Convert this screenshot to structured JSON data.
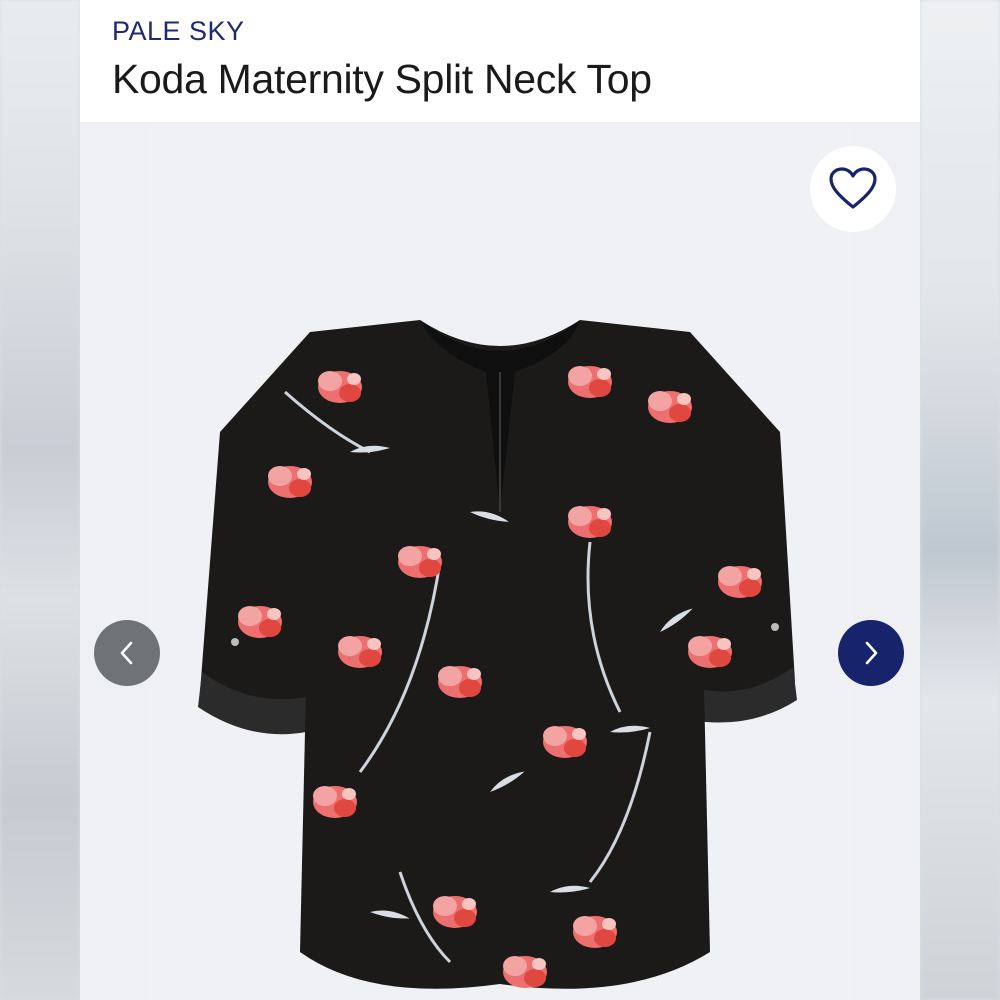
{
  "product": {
    "brand": "PALE SKY",
    "title": "Koda Maternity Split Neck Top"
  },
  "gallery": {
    "image_alt": "Koda Maternity Split Neck Top",
    "favorite_icon": "heart-outline-icon",
    "prev_icon": "chevron-left-icon",
    "next_icon": "chevron-right-icon"
  },
  "colors": {
    "brand_text": "#1f2b6e",
    "next_button": "#17246b",
    "prev_button": "#707376",
    "gallery_bg": "#eef0f3",
    "garment": "#1b1a19",
    "flower": "#ee6f6f"
  }
}
